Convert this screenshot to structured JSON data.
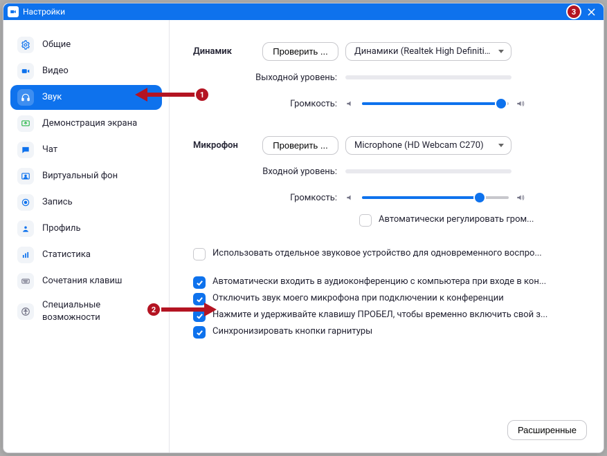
{
  "window": {
    "title": "Настройки"
  },
  "annotations": {
    "one": "1",
    "two": "2",
    "three": "3"
  },
  "sidebar": {
    "items": [
      {
        "label": "Общие"
      },
      {
        "label": "Видео"
      },
      {
        "label": "Звук"
      },
      {
        "label": "Демонстрация экрана"
      },
      {
        "label": "Чат"
      },
      {
        "label": "Виртуальный фон"
      },
      {
        "label": "Запись"
      },
      {
        "label": "Профиль"
      },
      {
        "label": "Статистика"
      },
      {
        "label": "Сочетания клавиш"
      },
      {
        "label": "Специальные возможности"
      }
    ]
  },
  "audio": {
    "speaker": {
      "title": "Динамик",
      "test_label": "Проверить ...",
      "device": "Динамики (Realtek High Definitio...",
      "output_level_label": "Выходной уровень:",
      "volume_label": "Громкость:",
      "volume_percent": 95
    },
    "mic": {
      "title": "Микрофон",
      "test_label": "Проверить ...",
      "device": "Microphone (HD Webcam C270)",
      "input_level_label": "Входной уровень:",
      "volume_label": "Громкость:",
      "volume_percent": 80,
      "auto_adjust_label": "Автоматически регулировать гром...",
      "auto_adjust_checked": false
    },
    "options": {
      "separate_audio": {
        "label": "Использовать отдельное звуковое устройство для одновременного воспро...",
        "checked": false
      },
      "auto_join": {
        "label": "Автоматически входить в аудиоконференцию с компьютера при входе в кон...",
        "checked": true
      },
      "mute_mic": {
        "label": "Отключить звук моего микрофона при подключении к конференции",
        "checked": true
      },
      "space_unmute": {
        "label": "Нажмите и удерживайте клавишу ПРОБЕЛ, чтобы временно включить свой з...",
        "checked": true
      },
      "sync_headset": {
        "label": "Синхронизировать кнопки гарнитуры",
        "checked": true
      }
    },
    "advanced_label": "Расширенные"
  }
}
